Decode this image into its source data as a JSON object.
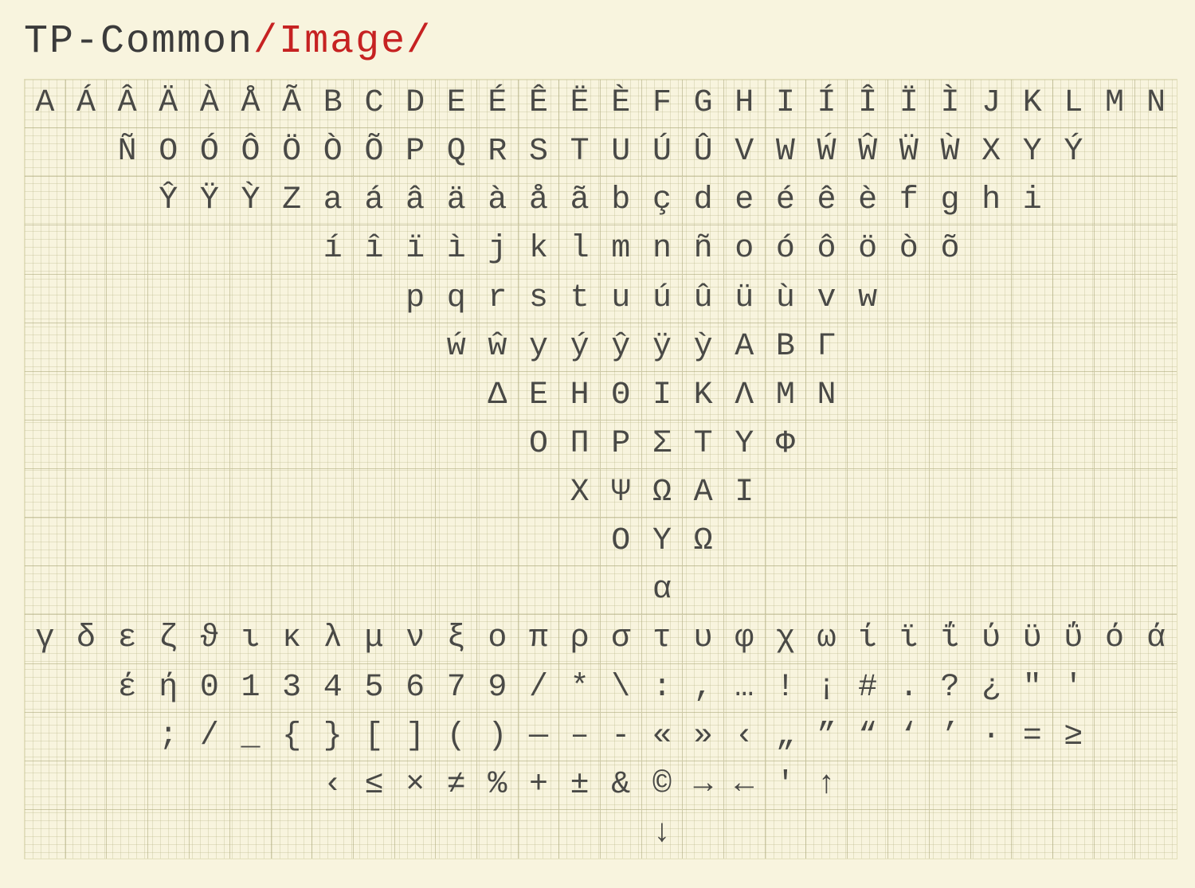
{
  "breadcrumb": {
    "root": "TP-Common",
    "sep": "/",
    "part": "Image"
  },
  "grid": {
    "cols": 28,
    "rows": 16
  },
  "glyph_rows": [
    [
      "A",
      "Á",
      "Â",
      "Ä",
      "À",
      "Å",
      "Ã",
      "B",
      "C",
      "D",
      "E",
      "É",
      "Ê",
      "Ë",
      "È",
      "F",
      "G",
      "H",
      "I",
      "Í",
      "Î",
      "Ï",
      "Ì",
      "J",
      "K",
      "L",
      "M",
      "N"
    ],
    [
      "",
      "",
      "Ñ",
      "O",
      "Ó",
      "Ô",
      "Ö",
      "Ò",
      "Õ",
      "P",
      "Q",
      "R",
      "S",
      "T",
      "U",
      "Ú",
      "Û",
      "V",
      "W",
      "Ẃ",
      "Ŵ",
      "Ẅ",
      "Ẁ",
      "X",
      "Y",
      "Ý",
      "",
      ""
    ],
    [
      "",
      "",
      "",
      "Ŷ",
      "Ÿ",
      "Ỳ",
      "Z",
      "a",
      "á",
      "â",
      "ä",
      "à",
      "å",
      "ã",
      "b",
      "ç",
      "d",
      "e",
      "é",
      "ê",
      "è",
      "f",
      "g",
      "h",
      "i",
      "",
      "",
      ""
    ],
    [
      "",
      "",
      "",
      "",
      "",
      "",
      "",
      "í",
      "î",
      "ï",
      "ì",
      "j",
      "k",
      "l",
      "m",
      "n",
      "ñ",
      "o",
      "ó",
      "ô",
      "ö",
      "ò",
      "õ",
      "",
      "",
      "",
      "",
      ""
    ],
    [
      "",
      "",
      "",
      "",
      "",
      "",
      "",
      "",
      "",
      "p",
      "q",
      "r",
      "s",
      "t",
      "u",
      "ú",
      "û",
      "ü",
      "ù",
      "v",
      "w",
      "",
      "",
      "",
      "",
      "",
      "",
      ""
    ],
    [
      "",
      "",
      "",
      "",
      "",
      "",
      "",
      "",
      "",
      "",
      "ẃ",
      "ŵ",
      "y",
      "ý",
      "ŷ",
      "ÿ",
      "ỳ",
      "Α",
      "Β",
      "Γ",
      "",
      "",
      "",
      "",
      "",
      "",
      "",
      ""
    ],
    [
      "",
      "",
      "",
      "",
      "",
      "",
      "",
      "",
      "",
      "",
      "",
      "Δ",
      "Ε",
      "Η",
      "Θ",
      "Ι",
      "Κ",
      "Λ",
      "Μ",
      "Ν",
      "",
      "",
      "",
      "",
      "",
      "",
      "",
      ""
    ],
    [
      "",
      "",
      "",
      "",
      "",
      "",
      "",
      "",
      "",
      "",
      "",
      "",
      "Ο",
      "Π",
      "Ρ",
      "Σ",
      "Τ",
      "Υ",
      "Φ",
      "",
      "",
      "",
      "",
      "",
      "",
      "",
      "",
      ""
    ],
    [
      "",
      "",
      "",
      "",
      "",
      "",
      "",
      "",
      "",
      "",
      "",
      "",
      "",
      "Χ",
      "Ψ",
      "Ω",
      "Α",
      "Ι",
      "",
      "",
      "",
      "",
      "",
      "",
      "",
      "",
      "",
      ""
    ],
    [
      "",
      "",
      "",
      "",
      "",
      "",
      "",
      "",
      "",
      "",
      "",
      "",
      "",
      "",
      "Ο",
      "Υ",
      "Ω",
      "",
      "",
      "",
      "",
      "",
      "",
      "",
      "",
      "",
      "",
      ""
    ],
    [
      "",
      "",
      "",
      "",
      "",
      "",
      "",
      "",
      "",
      "",
      "",
      "",
      "",
      "",
      "",
      "α",
      "",
      "",
      "",
      "",
      "",
      "",
      "",
      "",
      "",
      "",
      "",
      ""
    ],
    [
      "γ",
      "δ",
      "ε",
      "ζ",
      "ϑ",
      "ι",
      "κ",
      "λ",
      "μ",
      "ν",
      "ξ",
      "ο",
      "π",
      "ρ",
      "σ",
      "τ",
      "υ",
      "φ",
      "χ",
      "ω",
      "ί",
      "ϊ",
      "ΐ",
      "ύ",
      "ϋ",
      "ΰ",
      "ό",
      "ά"
    ],
    [
      "",
      "",
      "έ",
      "ή",
      "0",
      "1",
      "3",
      "4",
      "5",
      "6",
      "7",
      "9",
      "/",
      "*",
      "\\",
      ":",
      ",",
      "…",
      "!",
      "¡",
      "#",
      ".",
      "?",
      "¿",
      "\"",
      "'",
      "",
      ""
    ],
    [
      "",
      "",
      "",
      ";",
      "/",
      "_",
      "{",
      "}",
      "[",
      "]",
      "(",
      ")",
      "—",
      "–",
      "-",
      "«",
      "»",
      "‹",
      "„",
      "”",
      "“",
      "‘",
      "’",
      "·",
      "=",
      "≥",
      "",
      ""
    ],
    [
      "",
      "",
      "",
      "",
      "",
      "",
      "",
      "‹",
      "≤",
      "×",
      "≠",
      "%",
      "+",
      "±",
      "&",
      "©",
      "→",
      "←",
      "′",
      "↑",
      "",
      "",
      "",
      "",
      "",
      "",
      "",
      ""
    ],
    [
      "",
      "",
      "",
      "",
      "",
      "",
      "",
      "",
      "",
      "",
      "",
      "",
      "",
      "",
      "",
      "↓",
      "",
      "",
      "",
      "",
      "",
      "",
      "",
      "",
      "",
      "",
      "",
      ""
    ]
  ]
}
